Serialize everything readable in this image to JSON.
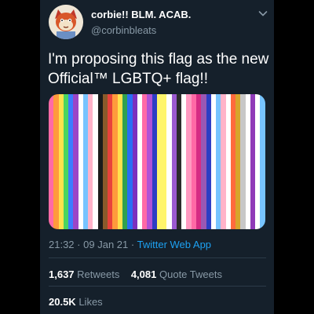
{
  "tweet": {
    "author": {
      "display_name": "corbie!! BLM. ACAB.",
      "handle": "@corbinbleats",
      "avatar_icon": "cartoon-avatar-icon"
    },
    "menu_icon": "chevron-down-icon",
    "text_lines": [
      "I'm proposing this flag as the new",
      "Official™ LGBTQ+ flag!!"
    ],
    "media": {
      "description_icon": "striped-pride-flag-image",
      "stripe_colors": [
        "#ff6aa6",
        "#ff9a3c",
        "#ffe14d",
        "#4ad45f",
        "#3c7cff",
        "#9b45c7",
        "#ffffff",
        "#77c4ff",
        "#ffb3c9",
        "#ffffff",
        "#1b1b1b",
        "#8a5a2b",
        "#e8413b",
        "#ff9a3c",
        "#ffe14d",
        "#30a14e",
        "#2a6df4",
        "#7b2fbf",
        "#ffffff",
        "#ff6aa6",
        "#b052d6",
        "#2d3ec4",
        "#fff56b",
        "#fff56b",
        "#ffffff",
        "#9b59d0",
        "#2b2b2b",
        "#ffffff",
        "#ff9ac1",
        "#ff6aa6",
        "#d62c84",
        "#9a58b4",
        "#2d3ec4",
        "#ffffff",
        "#77c4ff",
        "#ffb3c9",
        "#ffffff",
        "#ff6a3d",
        "#d7a52b",
        "#c7c7c7",
        "#ffffff",
        "#8f3ab8",
        "#ffffff",
        "#77c4ff"
      ]
    },
    "meta": {
      "time": "21:32",
      "separator": "·",
      "date": "09 Jan 21",
      "app": "Twitter Web App"
    },
    "stats": {
      "retweets_count": "1,637",
      "retweets_label": "Retweets",
      "quotes_count": "4,081",
      "quotes_label": "Quote Tweets",
      "likes_count": "20.5K",
      "likes_label": "Likes"
    }
  }
}
